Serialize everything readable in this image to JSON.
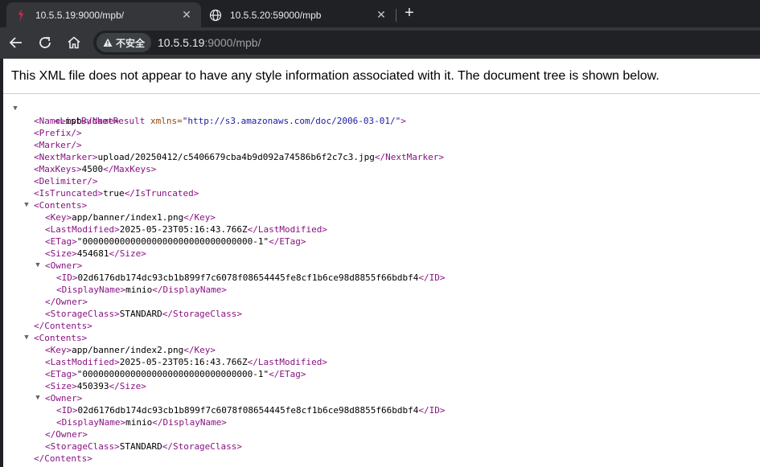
{
  "tabs": [
    {
      "title": "10.5.5.19:9000/mpb/",
      "active": true
    },
    {
      "title": "10.5.5.20:59000/mpb",
      "active": false
    }
  ],
  "toolbar": {
    "security_label": "不安全",
    "url_host": "10.5.5.19",
    "url_rest": ":9000/mpb/"
  },
  "info_message": "This XML file does not appear to have any style information associated with it. The document tree is shown below.",
  "xml": {
    "root_open_tag": "<ListBucketResult",
    "root_attr_name": "xmlns",
    "root_attr_value": "\"http://s3.amazonaws.com/doc/2006-03-01/\"",
    "root_gt": ">",
    "name": "mpb",
    "next_marker": "upload/20250412/c5406679cba4b9d092a74586b6f2c7c3.jpg",
    "max_keys": "4500",
    "is_truncated": "true",
    "contents": [
      {
        "key": "app/banner/index1.png",
        "last_modified": "2025-05-23T05:16:43.766Z",
        "etag": "\"00000000000000000000000000000000-1\"",
        "size": "454681",
        "owner_id": "02d6176db174dc93cb1b899f7c6078f08654445fe8cf1b6ce98d8855f66bdbf4",
        "display_name": "minio",
        "storage_class": "STANDARD"
      },
      {
        "key": "app/banner/index2.png",
        "last_modified": "2025-05-23T05:16:43.766Z",
        "etag": "\"00000000000000000000000000000000-1\"",
        "size": "450393",
        "owner_id": "02d6176db174dc93cb1b899f7c6078f08654445fe8cf1b6ce98d8855f66bdbf4",
        "display_name": "minio",
        "storage_class": "STANDARD"
      }
    ]
  },
  "colors": {
    "tag": "#881280",
    "attr_name": "#994500",
    "attr_value": "#1a1aa6",
    "chrome_bg": "#202124",
    "toolbar_bg": "#35363a"
  }
}
